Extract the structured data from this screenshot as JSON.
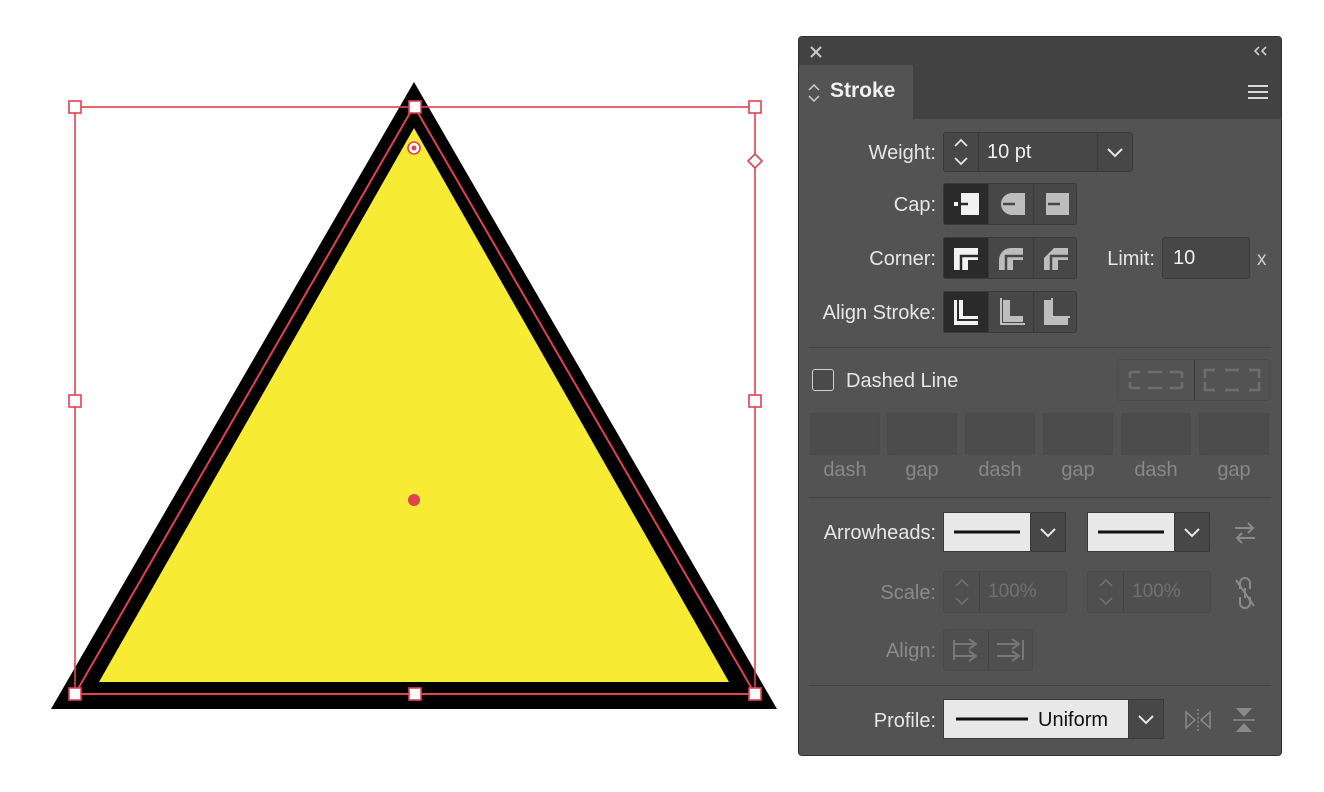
{
  "canvas": {
    "shape": "triangle",
    "fill_color": "#f7ec33",
    "stroke_color": "#000000",
    "selection_color": "#e0424f"
  },
  "panel": {
    "close_icon": "close-icon",
    "collapse_icon": "double-chevron-left-icon",
    "tab_label": "Stroke",
    "menu_icon": "hamburger-menu-icon",
    "weight": {
      "label": "Weight:",
      "value": "10 pt"
    },
    "cap": {
      "label": "Cap:",
      "options": [
        "butt-cap",
        "round-cap",
        "projecting-cap"
      ],
      "selected": 0
    },
    "corner": {
      "label": "Corner:",
      "options": [
        "miter-join",
        "round-join",
        "bevel-join"
      ],
      "selected": 0
    },
    "limit": {
      "label": "Limit:",
      "value": "10",
      "unit": "x"
    },
    "align_stroke": {
      "label": "Align Stroke:",
      "options": [
        "align-center",
        "align-inside",
        "align-outside"
      ],
      "selected": 0
    },
    "dashed": {
      "label": "Dashed Line",
      "checked": false,
      "fields": [
        "dash",
        "gap",
        "dash",
        "gap",
        "dash",
        "gap"
      ]
    },
    "arrowheads": {
      "label": "Arrowheads:"
    },
    "scale": {
      "label": "Scale:",
      "start": "100%",
      "end": "100%"
    },
    "align": {
      "label": "Align:"
    },
    "profile": {
      "label": "Profile:",
      "value": "Uniform"
    }
  }
}
